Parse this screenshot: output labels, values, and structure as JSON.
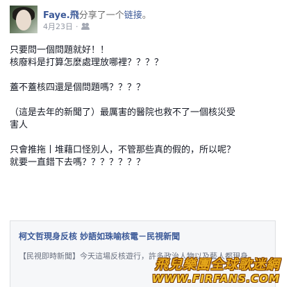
{
  "post": {
    "author": "Faye.飛",
    "verb": "分享了一个",
    "link_word": "链接",
    "period": "。",
    "date": "4月23日",
    "separator": "·",
    "privacy_icon": "people-icon"
  },
  "body": {
    "lines": [
      "只要問一個問題就好！！",
      "核廢料是打算怎麼處理放哪裡？？？？",
      "",
      "蓋不蓋核四還是個問題嗎？？？？",
      "",
      "（這是去年的新聞了）最厲害的醫院也救不了一個核災受",
      "害人",
      "",
      "只會推拖丨堆藉口怪別人，不管那些真的假的，所以呢？",
      "就要一直錯下去嗎？？？？？？？"
    ]
  },
  "shared_link": {
    "title": "柯文哲現身反核 妙語如珠喻核電－民視新聞",
    "description": "【民視即時新聞】今天這場反核遊行，許多政治人物以及藝人都現身"
  },
  "watermark": {
    "chinese": "飛兒樂團全球歌迷網",
    "url": "WWW.FIRFANS.COM"
  },
  "colors": {
    "link": "#3b5998",
    "text": "#141823",
    "meta": "#9197a3",
    "watermark_fill": "#e6a81a"
  }
}
